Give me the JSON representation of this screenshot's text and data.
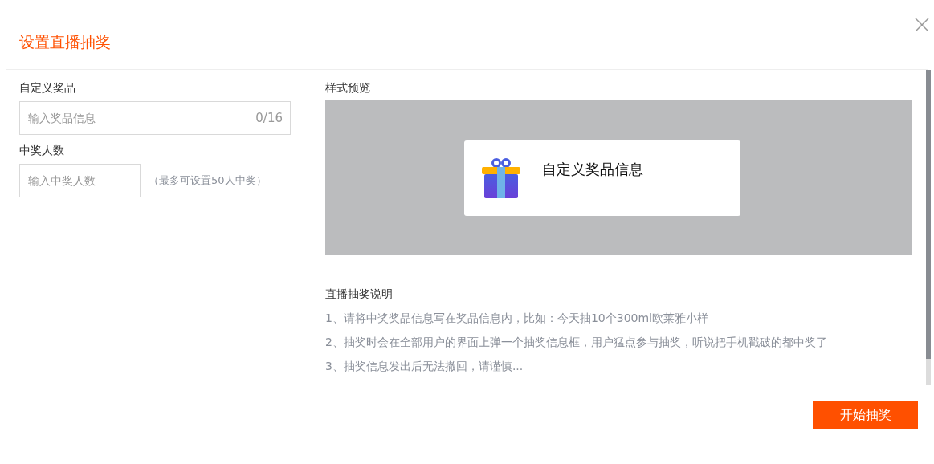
{
  "dialog": {
    "title": "设置直播抽奖"
  },
  "prize": {
    "label": "自定义奖品",
    "placeholder": "输入奖品信息",
    "counter": "0/16"
  },
  "winners": {
    "label": "中奖人数",
    "placeholder": "输入中奖人数",
    "hint": "（最多可设置50人中奖）"
  },
  "preview": {
    "label": "样式预览",
    "card_text": "自定义奖品信息"
  },
  "notes": {
    "title": "直播抽奖说明",
    "items": [
      "1、请将中奖奖品信息写在奖品信息内，比如：今天抽10个300ml欧莱雅小样",
      "2、抽奖时会在全部用户的界面上弹一个抽奖信息框，用户猛点参与抽奖，听说把手机戳破的都中奖了",
      "3、抽奖信息发出后无法撤回，请谨慎..."
    ]
  },
  "start_button": "开始抽奖"
}
